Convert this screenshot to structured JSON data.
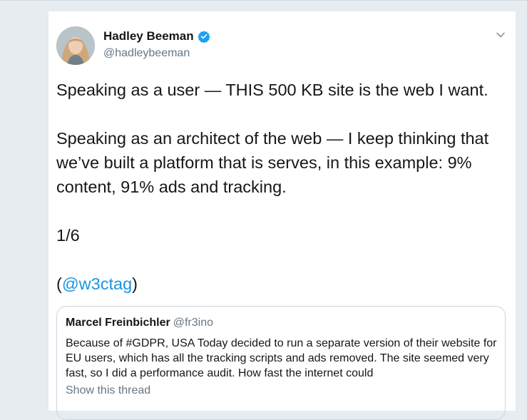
{
  "tweet": {
    "author_name": "Hadley Beeman",
    "author_handle": "@hadleybeeman",
    "paragraphs": [
      "Speaking as a user — THIS 500 KB site is the web I want.",
      "Speaking as an architect of the web — I keep thinking that we’ve built a platform that is serves, in this example: 9% content, 91% ads and tracking.",
      "1/6"
    ],
    "mention_open": "(",
    "mention": "@w3ctag",
    "mention_close": ")"
  },
  "quoted_tweet": {
    "author_name": "Marcel Freinbichler",
    "author_handle": "@fr3ino",
    "text": "Because of #GDPR, USA Today decided to run a separate version of their website for EU users, which has all the tracking scripts and ads removed. The site seemed very fast, so I did a performance audit. How fast the internet could",
    "show_thread": "Show this thread"
  },
  "icons": {
    "verified": "verified-badge-icon",
    "menu": "chevron-down-icon"
  },
  "colors": {
    "link": "#1b95e0",
    "verified": "#1da1f2",
    "secondary_text": "#657786",
    "page_background": "#e6ecf0"
  }
}
